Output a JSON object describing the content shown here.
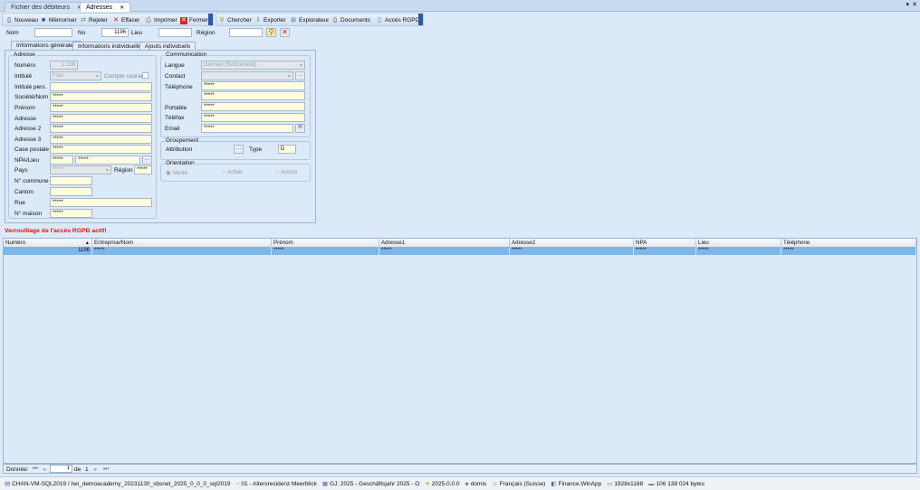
{
  "tabs": [
    {
      "label": "Fichier des débiteurs",
      "active": false
    },
    {
      "label": "Adresses",
      "active": true
    }
  ],
  "toolbar": {
    "new": "Nouveau",
    "save": "Mémoriser",
    "reject": "Rejeter",
    "delete": "Effacer",
    "print": "Imprimer",
    "close": "Fermer",
    "search": "Chercher",
    "export": "Exporter",
    "explorer": "Explorateur",
    "documents": "Documents",
    "rgpd": "Accès RGPD"
  },
  "search": {
    "nom_label": "Nom",
    "nom": "",
    "no_label": "No",
    "no": "1196",
    "lieu_label": "Lieu",
    "lieu": "",
    "region_label": "Région",
    "region": ""
  },
  "form_tabs": [
    "Informations générales",
    "Informations individuelles",
    "Ajouts individuels"
  ],
  "adresse": {
    "title": "Adresse",
    "numero_label": "Numéro",
    "numero": "1 196",
    "intitule_label": "Intitulé",
    "intitule": "Frau",
    "compte_courant": "Compte courant",
    "intitule_pers_label": "Intitulé pers.",
    "intitule_pers": "",
    "societe_label": "Société/Nom",
    "societe": "*****",
    "prenom_label": "Prénom",
    "prenom": "*****",
    "adresse_label": "Adresse",
    "adresse": "*****",
    "adresse2_label": "Adresse 2",
    "adresse2": "*****",
    "adresse3_label": "Adresse 3",
    "adresse3": "*****",
    "case_label": "Case postale",
    "case": "*****",
    "npa_label": "NPA/Lieu",
    "npa": "*****",
    "lieu": "*****",
    "pays_label": "Pays",
    "pays": "*****",
    "region_label": "Région",
    "region": "*****",
    "commune_label": "N° commune",
    "commune": "",
    "canton_label": "Canton",
    "canton": "",
    "rue_label": "Rue",
    "rue": "*****",
    "maison_label": "N° maison",
    "maison": "*****"
  },
  "communication": {
    "title": "Communication",
    "langue_label": "Langue",
    "langue": "German (Switzerland)",
    "contact_label": "Contact",
    "contact": "",
    "telephone_label": "Téléphone",
    "telephone": "*****",
    "telephone2": "*****",
    "portable_label": "Portable",
    "portable": "*****",
    "telefax_label": "Téléfax",
    "telefax": "*****",
    "email_label": "Email",
    "email": "*****"
  },
  "groupement": {
    "title": "Groupement",
    "attribution_label": "Attribution",
    "type_label": "Type",
    "type": "D"
  },
  "orientation": {
    "title": "Orientation",
    "options": [
      "Vente",
      "Achat",
      "Aucun"
    ],
    "selected": "Vente"
  },
  "warning": "Verrouillage de l'accès RGPD actif!",
  "grid": {
    "columns": [
      "Numéro",
      "Entreprise/Nom",
      "Prénom",
      "Adresse1",
      "Adresse2",
      "NPA",
      "Lieu",
      "Téléphone"
    ],
    "rows": [
      [
        "1196",
        "*****",
        "*****",
        "*****",
        "*****",
        "*****",
        "*****",
        "*****"
      ]
    ]
  },
  "nav": {
    "label": "Donnée:",
    "current": "1",
    "of": "de",
    "total": "1"
  },
  "status": [
    "CHAN-VM-SQL2019 / hei_demoacademy_20231130_sbsnet_2025_0_0_0_sql2019",
    "01 - Altersresidenz Meerblick",
    "GJ: 2025 - Geschäftsjahr 2025 - O",
    "2025.0.0.0",
    "domis",
    "Français (Suisse)",
    "Finance.WinApp",
    "1928x1168",
    "106 138 024 bytes"
  ],
  "colors": {
    "accent": "#2c5aa0",
    "warning": "#e81010",
    "selected_row": "#7fb6e8",
    "field": "#fffde0"
  }
}
